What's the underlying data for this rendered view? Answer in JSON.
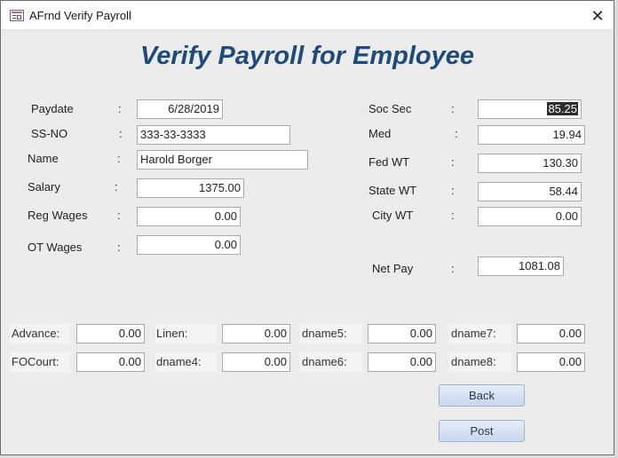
{
  "window": {
    "title": "AFrnd Verify Payroll",
    "icon": "form-icon",
    "close_glyph": "✕"
  },
  "heading": "Verify Payroll for Employee",
  "left_fields": [
    {
      "label": "Paydate",
      "value": "6/28/2019"
    },
    {
      "label": "SS-NO",
      "value": "333-33-3333"
    },
    {
      "label": "Name",
      "value": "Harold Borger"
    },
    {
      "label": "Salary",
      "value": "1375.00"
    },
    {
      "label": "Reg Wages",
      "value": "0.00"
    },
    {
      "label": "OT Wages",
      "value": "0.00"
    }
  ],
  "right_fields": [
    {
      "label": "Soc Sec",
      "value": "85.25"
    },
    {
      "label": "Med",
      "value": "19.94"
    },
    {
      "label": "Fed WT",
      "value": "130.30"
    },
    {
      "label": "State WT",
      "value": "58.44"
    },
    {
      "label": "City WT",
      "value": "0.00"
    },
    {
      "label": "Net Pay",
      "value": "1081.08"
    }
  ],
  "colon": ":",
  "deductions": [
    {
      "label": "Advance:",
      "value": "0.00"
    },
    {
      "label": "Linen:",
      "value": "0.00"
    },
    {
      "label": "dname5:",
      "value": "0.00"
    },
    {
      "label": "dname7:",
      "value": "0.00"
    },
    {
      "label": "FOCourt:",
      "value": "0.00"
    },
    {
      "label": "dname4:",
      "value": "0.00"
    },
    {
      "label": "dname6:",
      "value": "0.00"
    },
    {
      "label": "dname8:",
      "value": "0.00"
    }
  ],
  "buttons": {
    "back": "Back",
    "post": "Post"
  }
}
